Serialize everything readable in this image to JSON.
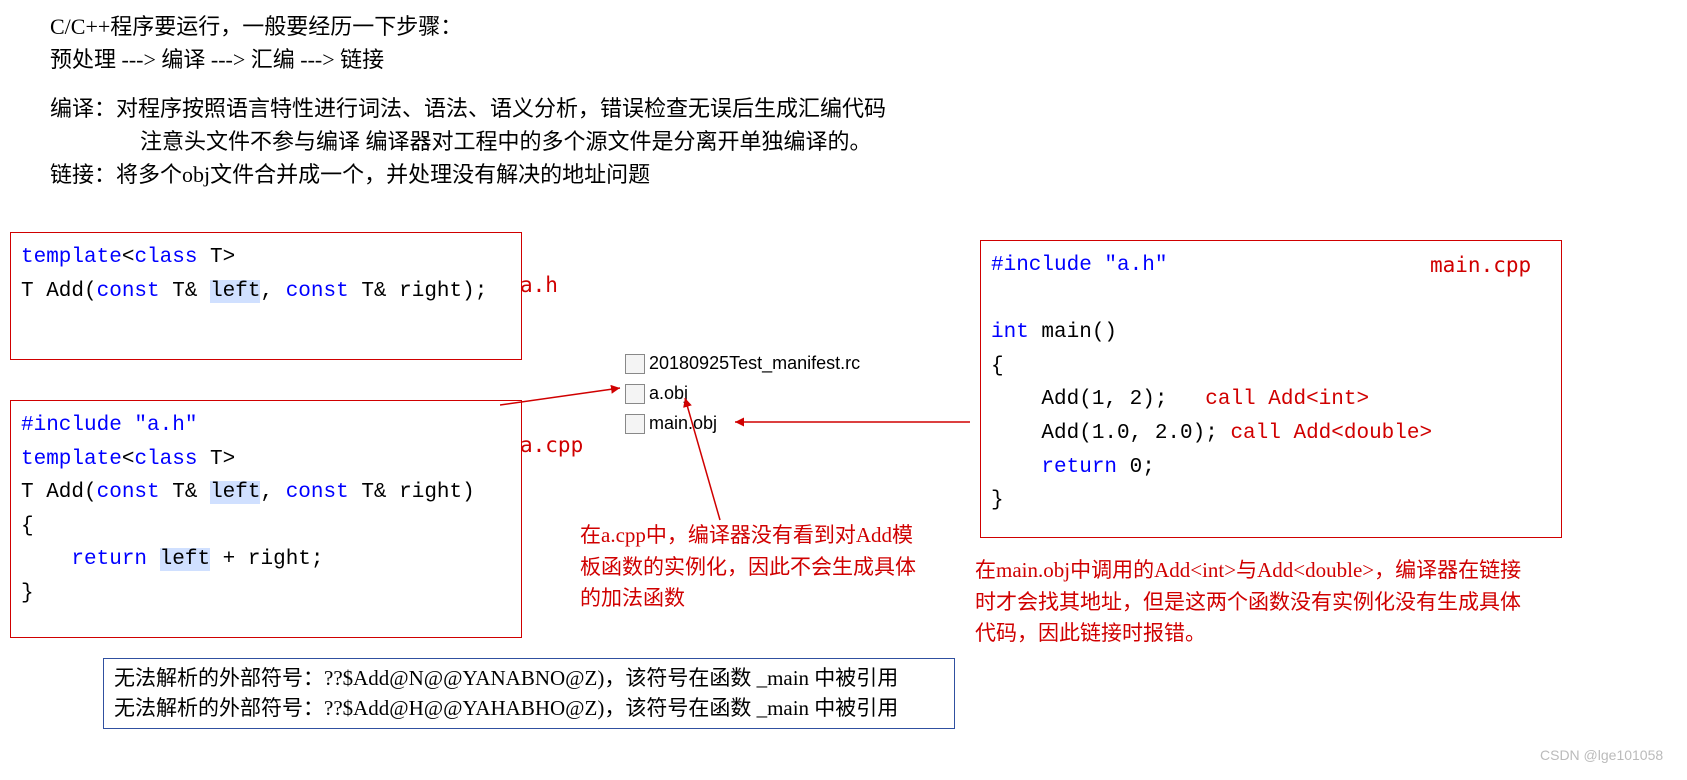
{
  "intro": {
    "line1": "C/C++程序要运行，一般要经历一下步骤：",
    "line2": "预处理 ---> 编译 ---> 汇编 ---> 链接",
    "line3": "编译：对程序按照语言特性进行词法、语法、语义分析，错误检查无误后生成汇编代码",
    "line4": "注意头文件不参与编译  编译器对工程中的多个源文件是分离开单独编译的。",
    "line5": "链接：将多个obj文件合并成一个，并处理没有解决的地址问题"
  },
  "labels": {
    "ah": "a.h",
    "acpp": "a.cpp",
    "maincpp": "main.cpp"
  },
  "code_ah": {
    "l1_a": "template",
    "l1_b": "<",
    "l1_c": "class",
    "l1_d": " T>",
    "l2_a": "T Add(",
    "l2_b": "const",
    "l2_c": " T& ",
    "l2_d": "left",
    "l2_e": ", ",
    "l2_f": "const",
    "l2_g": " T& right);"
  },
  "code_acpp": {
    "l1": "#include \"a.h\"",
    "l2_a": "template",
    "l2_b": "<",
    "l2_c": "class",
    "l2_d": " T>",
    "l3_a": "T Add(",
    "l3_b": "const",
    "l3_c": " T& ",
    "l3_d": "left",
    "l3_e": ", ",
    "l3_f": "const",
    "l3_g": " T& right)",
    "l4": "{",
    "l5_a": "    ",
    "l5_b": "return",
    "l5_c": " ",
    "l5_d": "left",
    "l5_e": " + right;",
    "l6": "}"
  },
  "code_main": {
    "l1": "#include \"a.h\"",
    "l2_a": "int",
    "l2_b": " main()",
    "l3": "{",
    "l4": "    Add(1, 2);",
    "l5": "    Add(1.0, 2.0);",
    "l6_a": "    ",
    "l6_b": "return",
    "l6_c": " 0;",
    "l7": "}",
    "c1": "call Add<int>",
    "c2": "call Add<double>"
  },
  "files": {
    "f1": "20180925Test_manifest.rc",
    "f2": "a.obj",
    "f3": "main.obj"
  },
  "note_acpp": "在a.cpp中，编译器没有看到对Add模板函数的实例化，因此不会生成具体的加法函数",
  "note_main": "在main.obj中调用的Add<int>与Add<double>，编译器在链接时才会找其地址，但是这两个函数没有实例化没有生成具体代码，因此链接时报错。",
  "errors": {
    "e1": "无法解析的外部符号：??$Add@N@@YANABNO@Z)，该符号在函数 _main 中被引用",
    "e2": "无法解析的外部符号：??$Add@H@@YAHABHO@Z)，该符号在函数 _main 中被引用"
  },
  "watermark": "CSDN @lge101058"
}
